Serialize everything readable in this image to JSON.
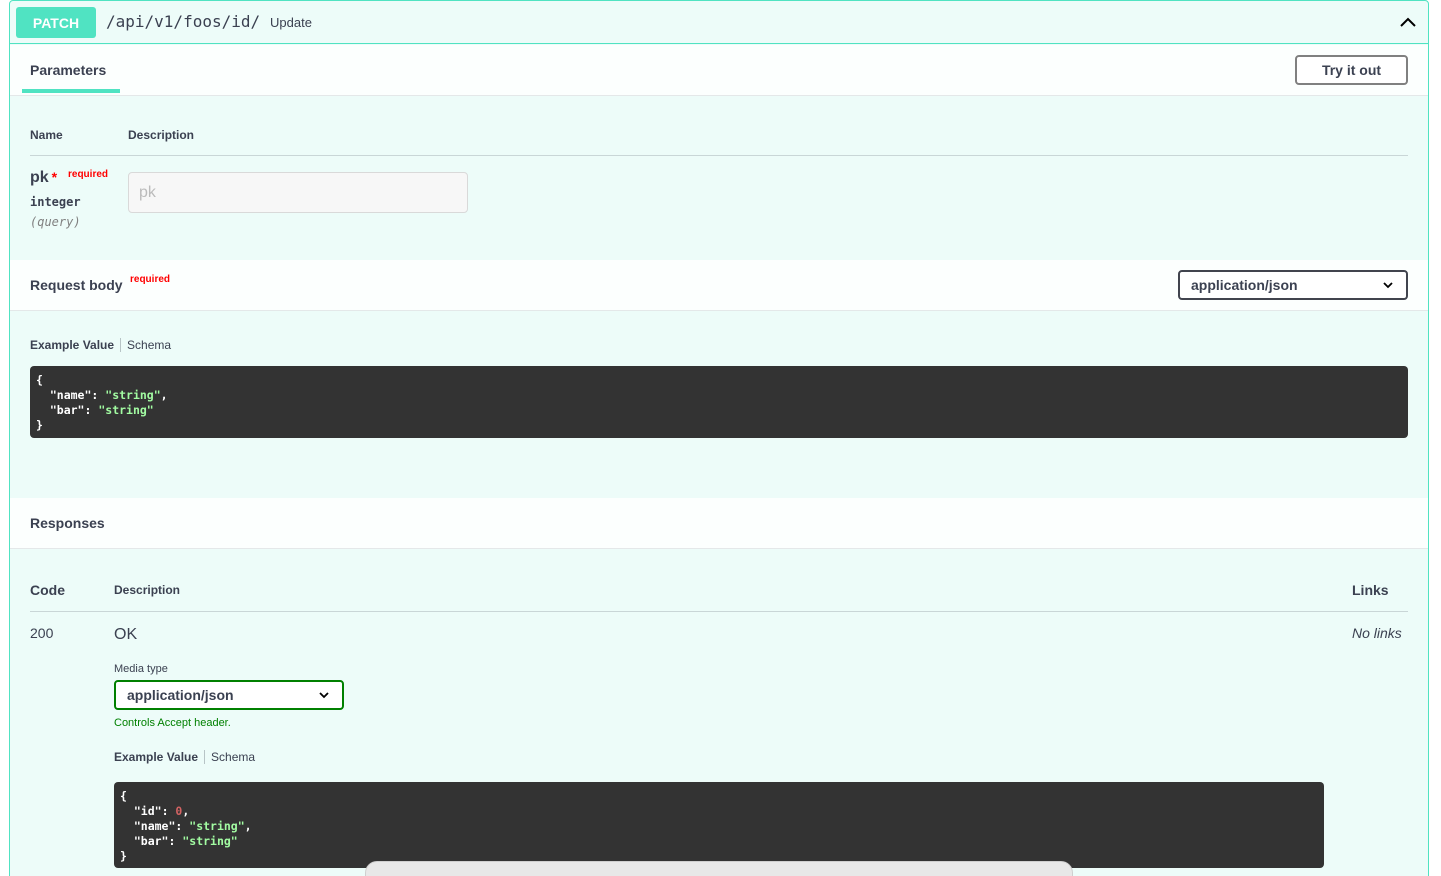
{
  "operation": {
    "method": "PATCH",
    "path": "/api/v1/foos/id/",
    "summary": "Update"
  },
  "parameters": {
    "tab_label": "Parameters",
    "try_button": "Try it out",
    "col_name": "Name",
    "col_description": "Description",
    "items": [
      {
        "name": "pk",
        "required_star": "*",
        "required_label": "required",
        "type": "integer",
        "in": "(query)",
        "placeholder": "pk"
      }
    ]
  },
  "request_body": {
    "title": "Request body",
    "required_label": "required",
    "content_type": "application/json",
    "example_tab": "Example Value",
    "schema_tab": "Schema",
    "example": {
      "name_key": "\"name\"",
      "name_val": "\"string\"",
      "bar_key": "\"bar\"",
      "bar_val": "\"string\""
    }
  },
  "responses": {
    "title": "Responses",
    "col_code": "Code",
    "col_description": "Description",
    "col_links": "Links",
    "items": [
      {
        "code": "200",
        "description": "OK",
        "links": "No links",
        "media_type_label": "Media type",
        "media_type": "application/json",
        "controls_hint": "Controls Accept header.",
        "example_tab": "Example Value",
        "schema_tab": "Schema",
        "example": {
          "id_key": "\"id\"",
          "id_val": "0",
          "name_key": "\"name\"",
          "name_val": "\"string\"",
          "bar_key": "\"bar\"",
          "bar_val": "\"string\""
        }
      }
    ]
  },
  "colors": {
    "patch_accent": "#50e3c2",
    "required": "#ff0000",
    "hint_green": "#008000",
    "code_bg": "#333333"
  }
}
